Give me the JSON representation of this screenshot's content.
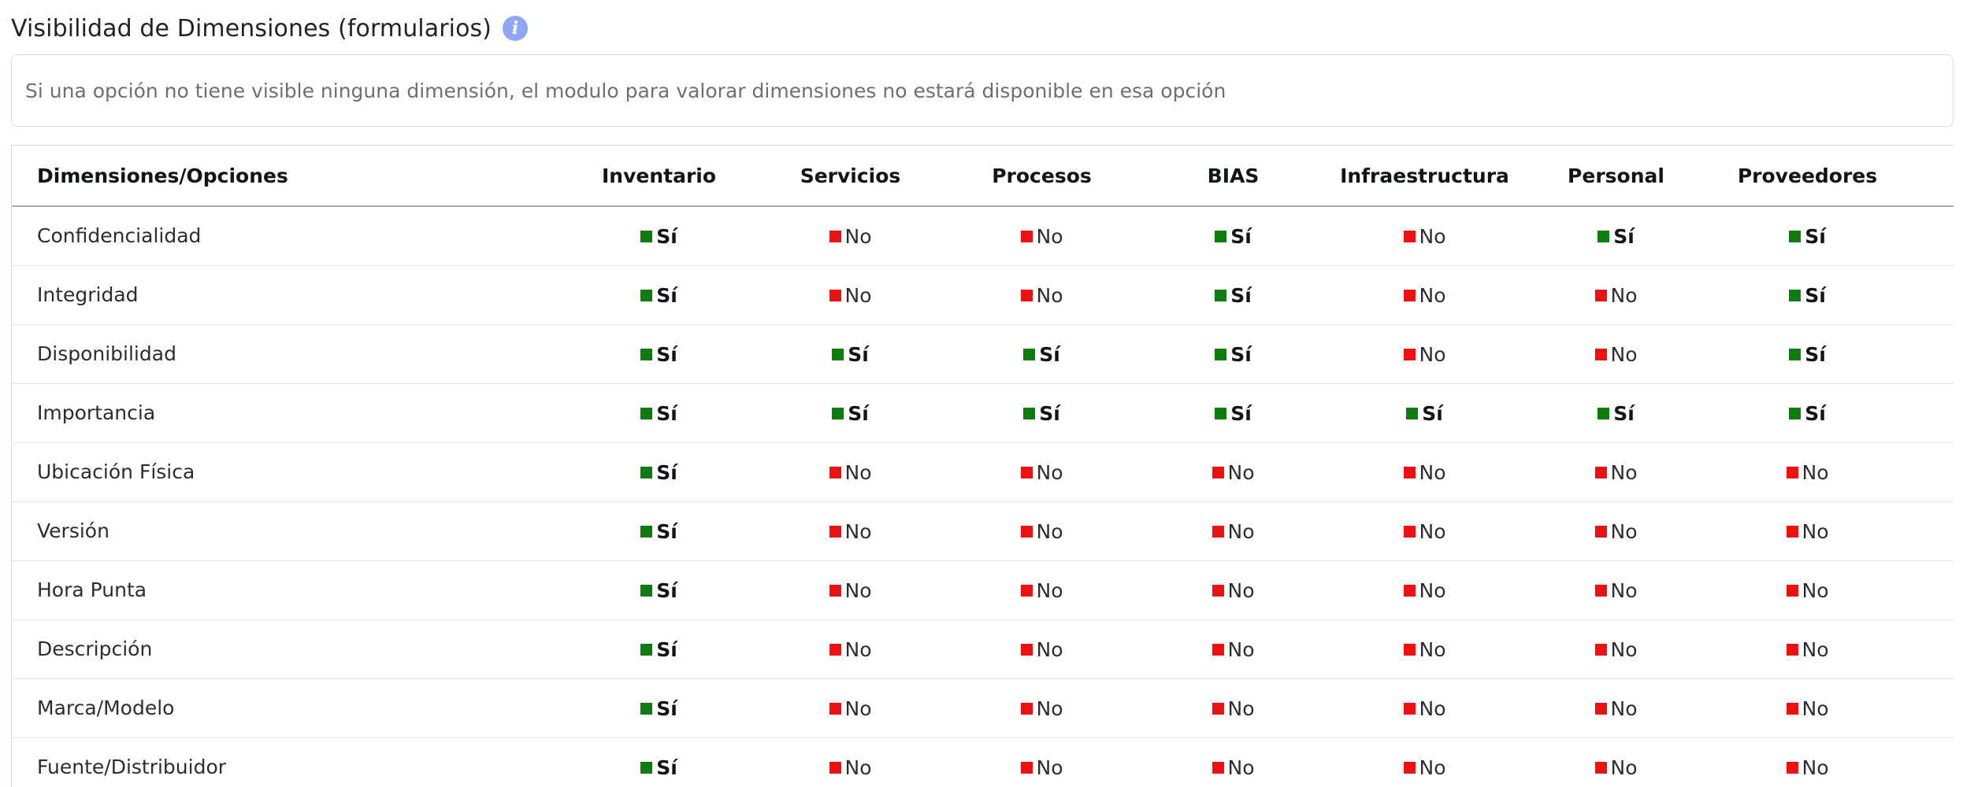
{
  "title": "Visibilidad de Dimensiones (formularios)",
  "info_icon": "info-icon",
  "notice": "Si una opción no tiene visible ninguna dimensión, el modulo para valorar dimensiones no estará disponible en esa opción",
  "colors": {
    "yes": "#0e7c0e",
    "no": "#ee1111",
    "info": "#8fa8f5"
  },
  "table": {
    "corner_header": "Dimensiones/Opciones",
    "columns": [
      "Inventario",
      "Servicios",
      "Procesos",
      "BIAS",
      "Infraestructura",
      "Personal",
      "Proveedores",
      ""
    ],
    "yes_label": "Sí",
    "no_label": "No",
    "rows": [
      {
        "name": "Confidencialidad",
        "values": [
          true,
          false,
          false,
          true,
          false,
          true,
          true
        ]
      },
      {
        "name": "Integridad",
        "values": [
          true,
          false,
          false,
          true,
          false,
          false,
          true
        ]
      },
      {
        "name": "Disponibilidad",
        "values": [
          true,
          true,
          true,
          true,
          false,
          false,
          true
        ]
      },
      {
        "name": "Importancia",
        "values": [
          true,
          true,
          true,
          true,
          true,
          true,
          true
        ]
      },
      {
        "name": "Ubicación Física",
        "values": [
          true,
          false,
          false,
          false,
          false,
          false,
          false
        ]
      },
      {
        "name": "Versión",
        "values": [
          true,
          false,
          false,
          false,
          false,
          false,
          false
        ]
      },
      {
        "name": "Hora Punta",
        "values": [
          true,
          false,
          false,
          false,
          false,
          false,
          false
        ]
      },
      {
        "name": "Descripción",
        "values": [
          true,
          false,
          false,
          false,
          false,
          false,
          false
        ]
      },
      {
        "name": "Marca/Modelo",
        "values": [
          true,
          false,
          false,
          false,
          false,
          false,
          false
        ]
      },
      {
        "name": "Fuente/Distribuidor",
        "values": [
          true,
          false,
          false,
          false,
          false,
          false,
          false
        ]
      }
    ]
  }
}
